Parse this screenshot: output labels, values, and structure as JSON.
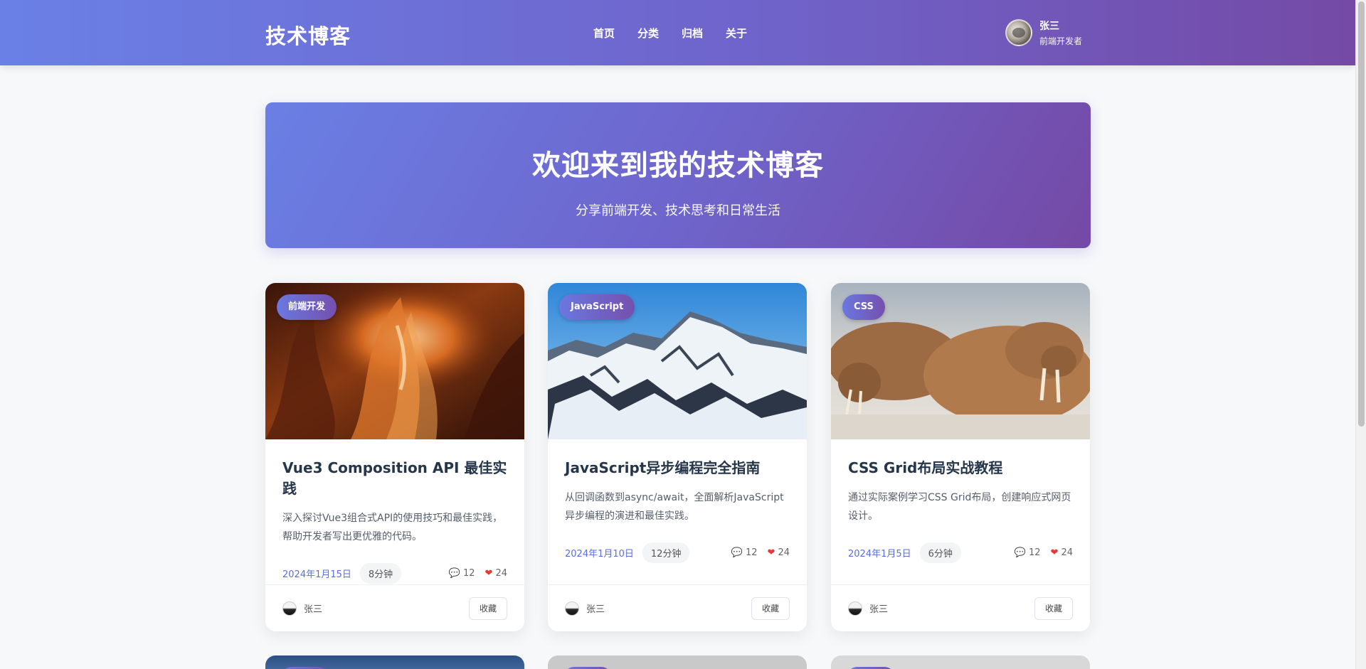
{
  "header": {
    "logo": "技术博客",
    "nav": [
      "首页",
      "分类",
      "归档",
      "关于"
    ],
    "user": {
      "name": "张三",
      "role": "前端开发者"
    }
  },
  "hero": {
    "title": "欢迎来到我的技术博客",
    "subtitle": "分享前端开发、技术思考和日常生活"
  },
  "posts": [
    {
      "tag": "前端开发",
      "title": "Vue3 Composition API 最佳实践",
      "desc": "深入探讨Vue3组合式API的使用技巧和最佳实践，帮助开发者写出更优雅的代码。",
      "date": "2024年1月15日",
      "read": "8分钟",
      "comments": "12",
      "likes": "24",
      "author": "张三",
      "fav": "收藏",
      "image": "canyon"
    },
    {
      "tag": "JavaScript",
      "title": "JavaScript异步编程完全指南",
      "desc": "从回调函数到async/await，全面解析JavaScript异步编程的演进和最佳实践。",
      "date": "2024年1月10日",
      "read": "12分钟",
      "comments": "12",
      "likes": "24",
      "author": "张三",
      "fav": "收藏",
      "image": "snowy-mountain"
    },
    {
      "tag": "CSS",
      "title": "CSS Grid布局实战教程",
      "desc": "通过实际案例学习CSS Grid布局，创建响应式网页设计。",
      "date": "2024年1月5日",
      "read": "6分钟",
      "comments": "12",
      "likes": "24",
      "author": "张三",
      "fav": "收藏",
      "image": "walruses"
    }
  ],
  "icons": {
    "comment": "speech-bubble-icon",
    "like": "heart-icon"
  },
  "colors": {
    "header_gradient_start": "#6a80e6",
    "header_gradient_end": "#744aa6",
    "accent": "#5a6fd8",
    "like": "#e53935"
  }
}
